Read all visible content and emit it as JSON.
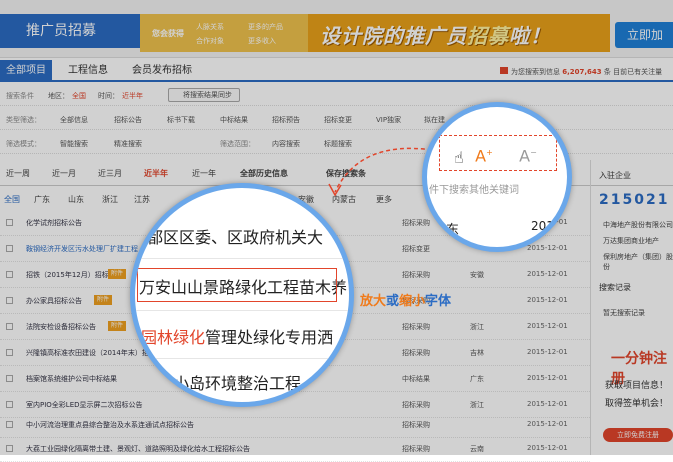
{
  "header": {
    "brand": "推广员招募",
    "banner_tag": "您会获得",
    "banner_items": [
      "人脉关系",
      "更多的产品",
      "合作对象",
      "更多收入"
    ],
    "banner_slogan_a": "设计院的推广员",
    "banner_slogan_b": "招募",
    "banner_slogan_c": "啦！",
    "join_label": "立即加"
  },
  "tabs": [
    "全部项目",
    "工程信息",
    "会员发布招标"
  ],
  "subscribe_text": "为您搜索到信息",
  "subscribe_count": "6,207,643",
  "subscribe_unit": "条",
  "subscribe_tail": "目前已有关注量",
  "search_row": {
    "label": "搜索条件",
    "area_label": "地区：",
    "area_value": "全国",
    "time_label": "时间：",
    "time_value": "近半年",
    "sync_label": "将搜索结果同步"
  },
  "type_row": {
    "label": "类型筛选：",
    "items": [
      "全部信息",
      "招标公告",
      "标书下载",
      "中标结果",
      "招标预告",
      "招标变更",
      "VIP独家",
      "拟在建"
    ]
  },
  "mode_row": {
    "label": "筛选模式：",
    "items": [
      "智能搜索",
      "精准搜索"
    ],
    "scope_label": "筛选范围：",
    "scope_items": [
      "内容搜索",
      "标题搜索"
    ]
  },
  "periods": [
    "近一周",
    "近一月",
    "近三月",
    "近半年",
    "近一年",
    "全部历史信息",
    "保存搜索条"
  ],
  "regions": [
    "全国",
    "广东",
    "山东",
    "浙江",
    "江苏",
    "安徽",
    "内蒙古",
    "更多"
  ],
  "search_placeholder": "件下搜索其他关键词",
  "listings": [
    {
      "title": "化学试剂招标公告",
      "hot": "",
      "type": "招标采购",
      "prov": "",
      "date": "2015-12-01"
    },
    {
      "title": "鞍钢经济开发区污水处理厂扩建工程",
      "hot": "",
      "type": "招标变更",
      "prov": "",
      "date": "2015-12-01"
    },
    {
      "title": "招铁（2015年12月）招标公告",
      "hot": "附件",
      "type": "招标采购",
      "prov": "安徽",
      "date": "2015-12-01"
    },
    {
      "title": "办公家具招标公告",
      "hot": "附件",
      "type": "招标采购",
      "prov": "",
      "date": "2015-12-01"
    },
    {
      "title": "法院安检设备招标公告",
      "hot": "附件",
      "type": "招标采购",
      "prov": "浙江",
      "date": "2015-12-01"
    },
    {
      "title": "兴隆镇高标准农田建设（2014年末）招标",
      "hot": "",
      "type": "招标采购",
      "prov": "吉林",
      "date": "2015-12-01"
    },
    {
      "title": "档案馆系统维护公司中标结果",
      "hot": "",
      "type": "中标结果",
      "prov": "广东",
      "date": "2015-12-01"
    },
    {
      "title": "室内PIO全彩LED显示屏二次招标公告",
      "hot": "",
      "type": "招标采购",
      "prov": "浙江",
      "date": "2015-12-01"
    },
    {
      "title": "中小河流治理重点县综合整治及水系连通试点招标公告",
      "hot": "",
      "type": "招标采购",
      "prov": "",
      "date": "2015-12-01"
    },
    {
      "title": "大荔工业园绿化隔离带土建、景观灯、道路照明及绿化给水工程招标公告",
      "hot": "",
      "type": "招标采购",
      "prov": "云南",
      "date": "2015-12-01"
    }
  ],
  "sidebar": {
    "title": "入驻企业",
    "count": "215021",
    "companies": [
      "中海地产股份有限公司",
      "万达集团商业地产",
      "保利房地产（集团）股份"
    ],
    "records_title": "搜索记录",
    "records_empty": "暂无搜索记录",
    "reg_title": "一分钟注册",
    "reg_lines": [
      "获取项目信息！",
      "取得签单机会！"
    ],
    "reg_btn": "立即免费注册"
  },
  "magnifier": {
    "lines": [
      "北都区区委、区政府机关大",
      "万安山山景路绿化工程苗木养",
      "管理处绿化专用洒",
      "小岛环境整治工程"
    ],
    "green_prefix": "园林绿化",
    "font_plus": "A",
    "font_minus": "A",
    "zoom_prov": "山东",
    "zoom_year": "201"
  },
  "callout": {
    "a": "放大",
    "or": "或",
    "b": "缩小",
    "c": "字体"
  },
  "colors": {
    "accent": "#2b6cc4",
    "highlight": "#e2452b",
    "orange": "#f07a1a"
  }
}
